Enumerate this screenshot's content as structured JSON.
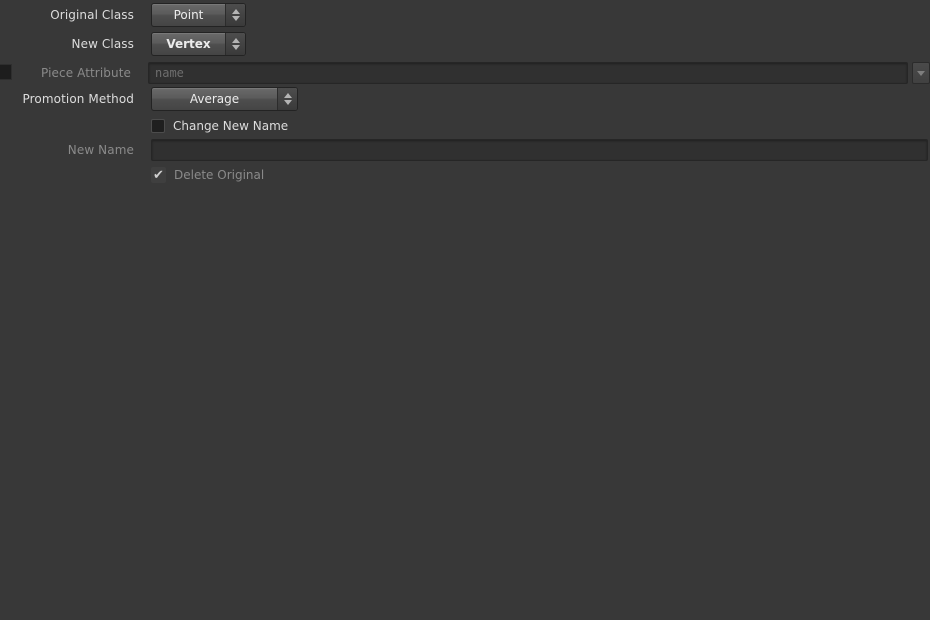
{
  "panel": {
    "background_color": "#383838",
    "text_color": "#dcdcdc",
    "disabled_text_color": "#8a8a8a"
  },
  "rows": {
    "original_class": {
      "label": "Original Class",
      "value": "Point",
      "spin_up_icon": "triangle-up-icon",
      "spin_down_icon": "triangle-down-icon"
    },
    "new_class": {
      "label": "New Class",
      "value": "Vertex",
      "spin_up_icon": "triangle-up-icon",
      "spin_down_icon": "triangle-down-icon"
    },
    "piece_attribute": {
      "label": "Piece Attribute",
      "value": "",
      "placeholder": "name",
      "dropdown_icon": "chevron-down-icon",
      "disabled": true
    },
    "promotion_method": {
      "label": "Promotion Method",
      "value": "Average",
      "spin_up_icon": "triangle-up-icon",
      "spin_down_icon": "triangle-down-icon"
    },
    "change_new_name": {
      "label": "Change New Name",
      "checked": false,
      "checkbox_icon": "checkbox-unchecked-icon"
    },
    "new_name": {
      "label": "New Name",
      "value": "",
      "placeholder": "",
      "disabled": true
    },
    "delete_original": {
      "label": "Delete Original",
      "checked": true,
      "checkbox_icon": "checkmark-icon",
      "check_glyph": "✔",
      "disabled": true
    }
  },
  "edge_marker": {
    "icon": "parameter-override-marker-icon"
  }
}
